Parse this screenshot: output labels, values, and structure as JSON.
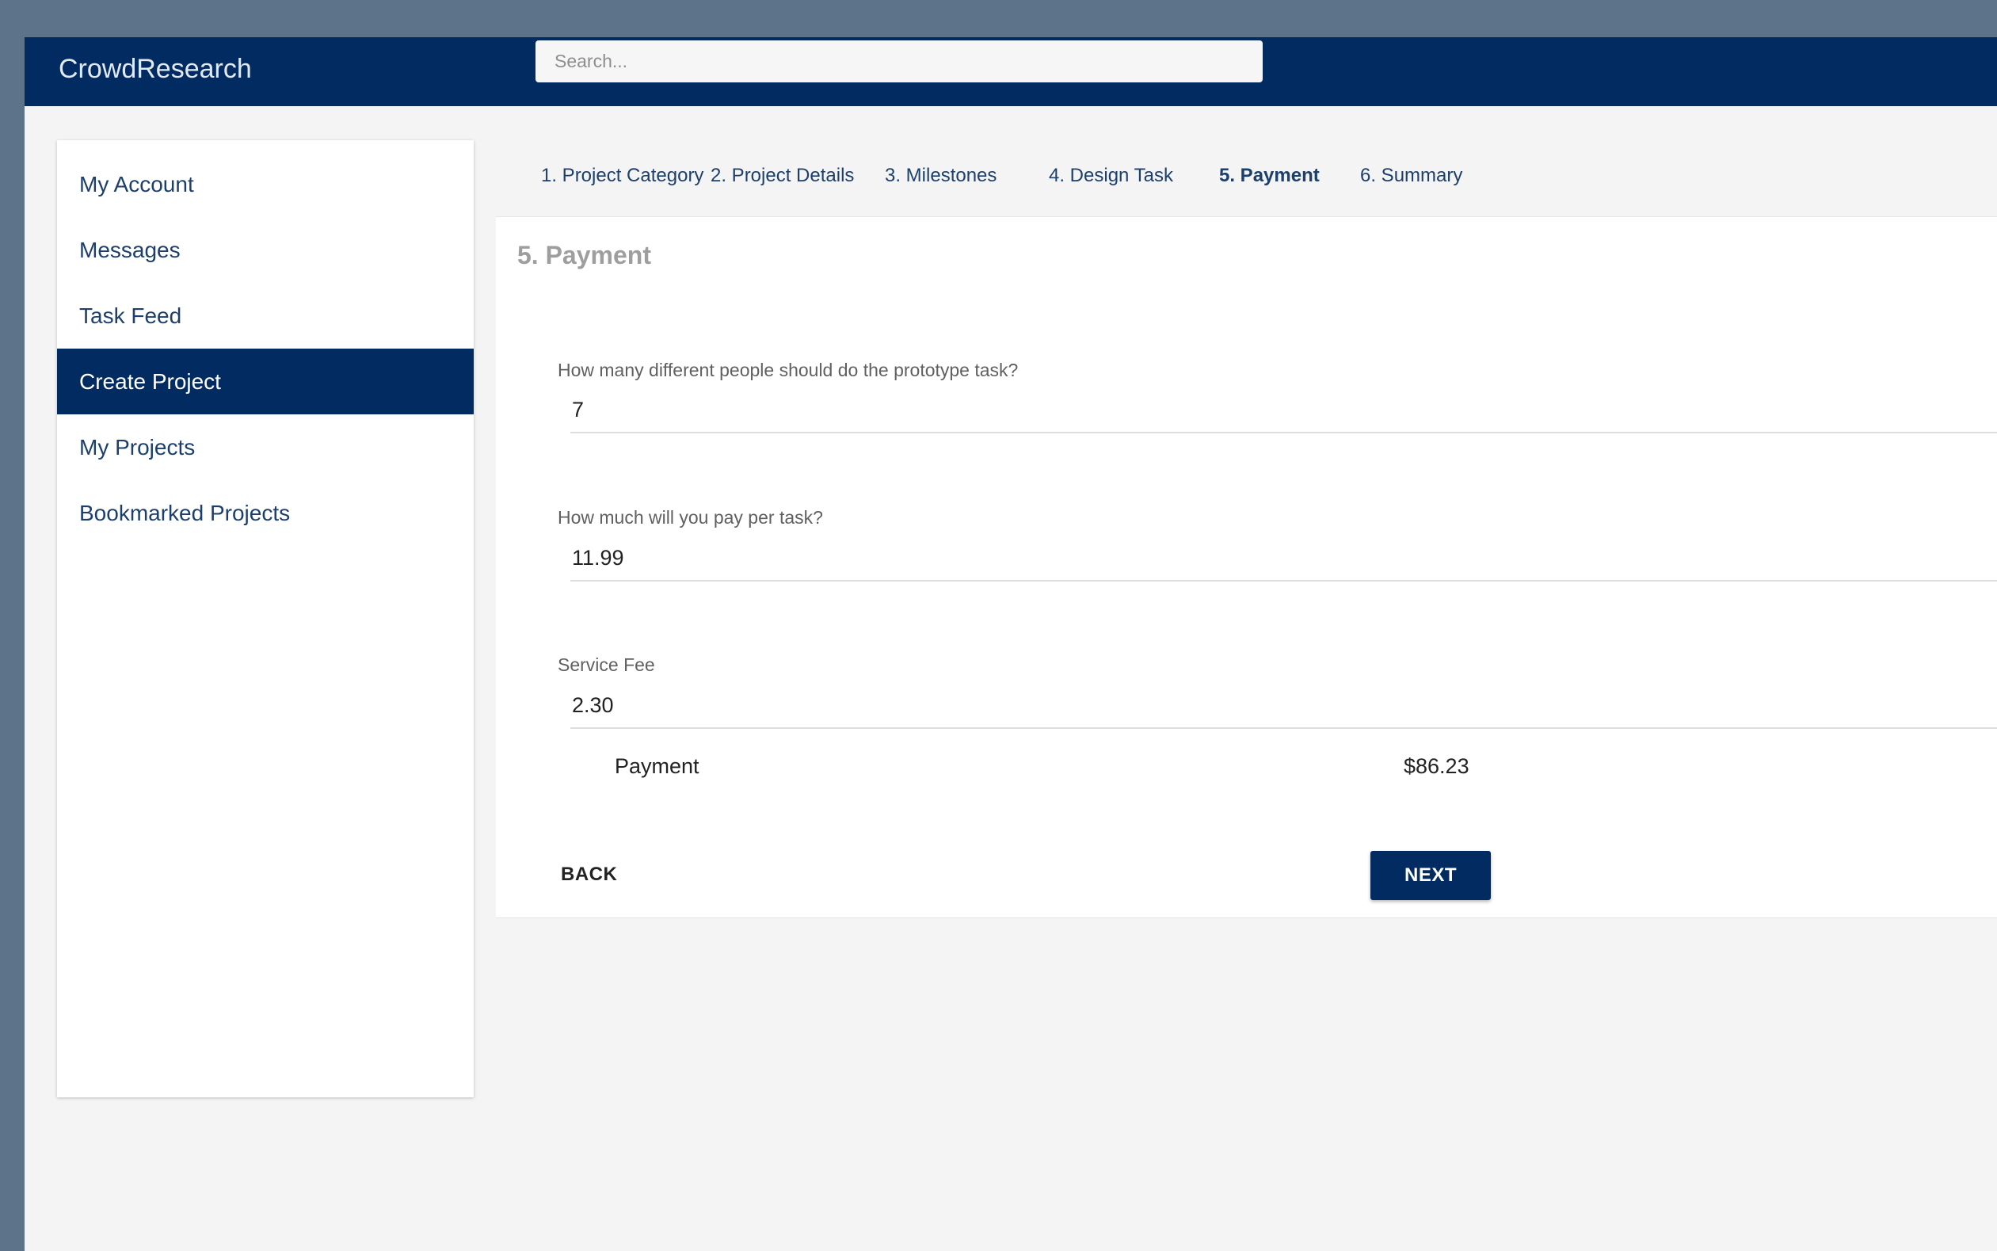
{
  "header": {
    "brand": "CrowdResearch",
    "search_placeholder": "Search..."
  },
  "sidebar": {
    "items": [
      {
        "label": "My Account"
      },
      {
        "label": "Messages"
      },
      {
        "label": "Task Feed"
      },
      {
        "label": "Create Project",
        "active": true
      },
      {
        "label": "My Projects"
      },
      {
        "label": "Bookmarked Projects"
      }
    ]
  },
  "steps": [
    {
      "label": "1. Project Category"
    },
    {
      "label": "2. Project Details"
    },
    {
      "label": "3. Milestones"
    },
    {
      "label": "4. Design Task"
    },
    {
      "label": "5. Payment",
      "active": true
    },
    {
      "label": "6. Summary"
    }
  ],
  "form": {
    "title": "5. Payment",
    "fields": [
      {
        "label": "How many different people should do the prototype task?",
        "value": "7"
      },
      {
        "label": "How much will you pay per task?",
        "value": "11.99"
      },
      {
        "label": "Service Fee",
        "value": "2.30"
      }
    ],
    "total_label": "Payment",
    "total_value": "$86.23",
    "back_label": "BACK",
    "next_label": "NEXT"
  },
  "colors": {
    "primary": "#022b61",
    "desktop": "#5d7389",
    "background": "#f4f4f4",
    "title_gray": "#9e9e9e"
  }
}
